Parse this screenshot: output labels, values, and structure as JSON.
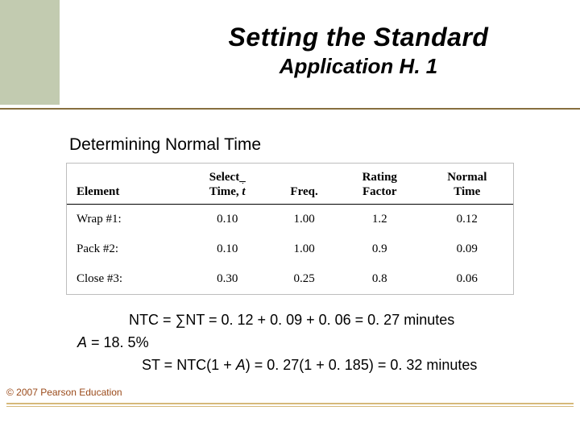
{
  "title": "Setting the Standard",
  "subtitle_top": "Application H. 1",
  "section": "Determining Normal Time",
  "table": {
    "headers": {
      "element": "Element",
      "select_time": "Select_",
      "select_time2_prefix": "Time, ",
      "select_time2_var": "t",
      "freq": "Freq.",
      "rating": "Rating",
      "rating2": "Factor",
      "normal": "Normal",
      "normal2": "Time"
    },
    "rows": [
      {
        "element": "Wrap #1:",
        "select_time": "0.10",
        "freq": "1.00",
        "rating": "1.2",
        "normal": "0.12"
      },
      {
        "element": "Pack #2:",
        "select_time": "0.10",
        "freq": "1.00",
        "rating": "0.9",
        "normal": "0.09"
      },
      {
        "element": "Close #3:",
        "select_time": "0.30",
        "freq": "0.25",
        "rating": "0.8",
        "normal": "0.06"
      }
    ]
  },
  "equations": {
    "ntc": "NTC = ∑NT = 0. 12 + 0. 09 + 0. 06 = 0. 27 minutes",
    "a_label": "A",
    "a_rest": " = 18. 5%",
    "st_prefix": "ST = NTC(1 + ",
    "st_a1": "A",
    "st_rest": ") = 0. 27(1 + 0. 185) = 0. 32 minutes"
  },
  "copyright": "© 2007 Pearson Education"
}
